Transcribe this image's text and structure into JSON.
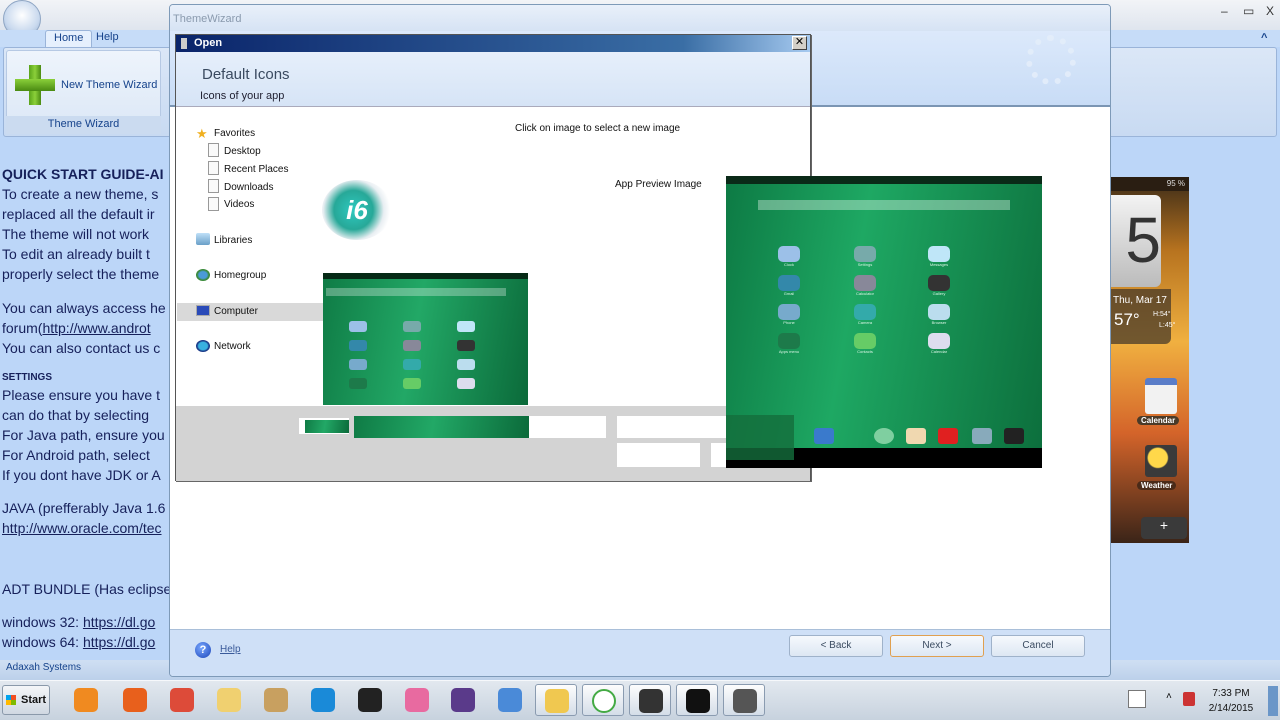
{
  "app": {
    "title_buttons": {
      "minimize": "–",
      "maximize": "▭",
      "close": "X"
    },
    "ribbon_tabs": [
      "Home",
      "Help"
    ],
    "collapse_ribbon": "^",
    "group": {
      "button_label": "New Theme Wizard",
      "group_label": "Theme Wizard"
    },
    "guide": {
      "heading": "QUICK START GUIDE-AI",
      "lines": [
        "To create a new theme, s",
        "replaced all the default ir",
        "The theme will not work",
        "To edit an already built t",
        "properly select the theme",
        "You can always access he",
        "forum(",
        "You can also contact us c"
      ],
      "forum_link": "http://www.androt",
      "settings_heading": "SETTINGS",
      "settings_lines": [
        "Please ensure you have t",
        "can do that by selecting",
        "For Java path, ensure you",
        "For Android path, select",
        "If you dont have JDK or A"
      ],
      "java_line": "JAVA (prefferably Java 1.6",
      "java_link": "http://www.oracle.com/tec",
      "adt_line": "ADT BUNDLE (Has eclipse",
      "win32_label": "windows 32: ",
      "win32_link": "https://dl.go",
      "win64_label": "windows 64: ",
      "win64_link": "https://dl.go"
    },
    "status": "Adaxah Systems"
  },
  "wizard": {
    "title": "ThemeWizard",
    "header_title": "Default Icons",
    "header_subtitle": "Icons of your app",
    "click_text": "Click on image to select a new image",
    "preview_label": "App Preview Image",
    "icon_text": "i6",
    "help": "Help",
    "back": "<  Back",
    "next": "Next  >",
    "cancel": "Cancel",
    "apps": [
      "Clock",
      "Settings",
      "Messages",
      "Gmail",
      "Calculator",
      "Gallery",
      "Phone",
      "Camera",
      "Browser",
      "Apps menu",
      "Contacts",
      "Calendar"
    ]
  },
  "open_dialog": {
    "title": "Open",
    "close": "✕",
    "nav": {
      "favorites": "Favorites",
      "favorite_items": [
        "Desktop",
        "Recent Places",
        "Downloads",
        "Videos"
      ],
      "libraries": "Libraries",
      "homegroup": "Homegroup",
      "computer": "Computer",
      "network": "Network"
    },
    "selected": "Computer"
  },
  "htc_widget": {
    "battery": "95 %",
    "clock_digit": "5",
    "date": "Thu, Mar 17",
    "temp": "57°",
    "hi": "H:54°",
    "lo": "L:45°",
    "calendar": "Calendar",
    "weather": "Weather",
    "add": "+"
  },
  "taskbar": {
    "start": "Start",
    "apps": [
      "media-player",
      "firefox",
      "chrome",
      "folder",
      "paint",
      "internet-explorer",
      "xampp",
      "picasa",
      "eclipse",
      "control-panel",
      "file-explorer",
      "google-talk",
      "app-installer",
      "android-emulator",
      "theme-app"
    ],
    "time": "7:33 PM",
    "date": "2/14/2015"
  }
}
